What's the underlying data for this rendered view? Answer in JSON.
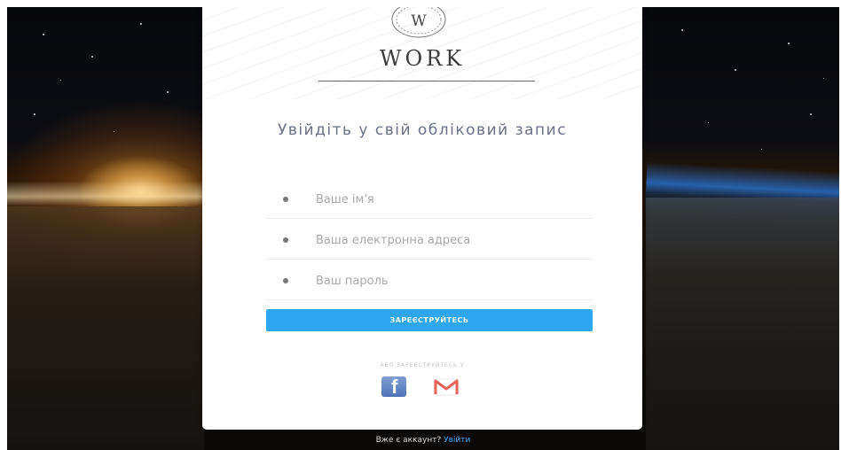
{
  "logo": {
    "emblem_letter": "W",
    "brand": "WORK"
  },
  "form": {
    "heading": "Увійдіть у свій обліковий запис",
    "name_placeholder": "Ваше ім'я",
    "email_placeholder": "Ваша електронна адреса",
    "password_placeholder": "Ваш пароль",
    "submit_label": "ЗАРЕЄСТРУЙТЕСЬ",
    "or_text": "АБО ЗАРЕЄСТРУЙТЕСЬ У"
  },
  "social": {
    "facebook_icon": "facebook-icon",
    "gmail_icon": "gmail-icon",
    "facebook_glyph": "f"
  },
  "footer": {
    "text": "Вже є аккаунт?",
    "link_label": "Увійти"
  },
  "colors": {
    "accent": "#2ea7f0",
    "heading": "#6b7184"
  }
}
